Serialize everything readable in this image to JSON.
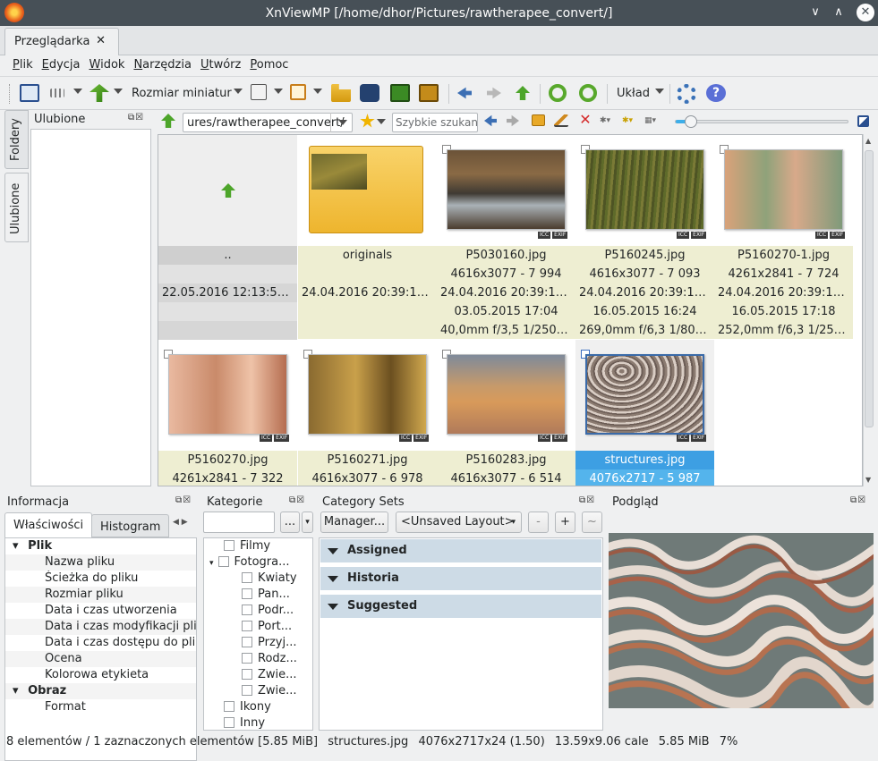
{
  "window": {
    "title": "XnViewMP [/home/dhor/Pictures/rawtherapee_convert/]",
    "min": "∨",
    "max": "∧",
    "close": "✕"
  },
  "tab": {
    "label": "Przeglądarka",
    "close": "✕"
  },
  "menu": [
    "Plik",
    "Edycja",
    "Widok",
    "Narzędzia",
    "Utwórz",
    "Pomoc"
  ],
  "toolbar": {
    "thumb_size": "Rozmiar miniatur",
    "layout": "Układ"
  },
  "sidetabs": {
    "folders": "Foldery",
    "favorites": "Ulubione"
  },
  "favorites": {
    "title": "Ulubione"
  },
  "address": {
    "path": "ures/rawtherapee_convert/",
    "search_placeholder": "Szybkie szukanie",
    "zoom_fraction": 0.07
  },
  "items": [
    {
      "name": "..",
      "size": "",
      "created": "22.05.2016 12:13:57 C...",
      "date": "",
      "exif": "",
      "type": "parent"
    },
    {
      "name": "originals",
      "size": "",
      "created": "24.04.2016 20:39:16 C...",
      "date": "",
      "exif": "",
      "type": "folder"
    },
    {
      "name": "P5030160.jpg",
      "size": "4616x3077 - 7 994",
      "created": "24.04.2016 20:39:17 C...",
      "date": "03.05.2015 17:04",
      "exif": "40,0mm f/3,5 1/250s 2...",
      "type": "photo"
    },
    {
      "name": "P5160245.jpg",
      "size": "4616x3077 - 7 093",
      "created": "24.04.2016 20:39:18 C...",
      "date": "16.05.2015 16:24",
      "exif": "269,0mm f/6,3 1/800s ...",
      "type": "photo"
    },
    {
      "name": "P5160270-1.jpg",
      "size": "4261x2841 - 7 724",
      "created": "24.04.2016 20:39:17 C...",
      "date": "16.05.2015 17:18",
      "exif": "252,0mm f/6,3 1/250s ...",
      "type": "photo"
    },
    {
      "name": "P5160270.jpg",
      "size": "4261x2841 - 7 322",
      "type": "photo"
    },
    {
      "name": "P5160271.jpg",
      "size": "4616x3077 - 6 978",
      "type": "photo"
    },
    {
      "name": "P5160283.jpg",
      "size": "4616x3077 - 6 514",
      "type": "photo"
    },
    {
      "name": "structures.jpg",
      "size": "4076x2717 - 5 987",
      "type": "photo",
      "selected": true
    }
  ],
  "badges": {
    "icc": "ICC",
    "exif": "EXIF"
  },
  "info": {
    "title": "Informacja",
    "tab_props": "Właściwości",
    "tab_hist": "Histogram",
    "rows": [
      {
        "label": "Plik",
        "group": true
      },
      {
        "label": "Nazwa pliku"
      },
      {
        "label": "Ścieżka do pliku"
      },
      {
        "label": "Rozmiar pliku"
      },
      {
        "label": "Data i czas utworzenia"
      },
      {
        "label": "Data i czas modyfikacji pli"
      },
      {
        "label": "Data i czas dostępu do pli"
      },
      {
        "label": "Ocena"
      },
      {
        "label": "Kolorowa etykieta"
      },
      {
        "label": "Obraz",
        "group": true
      },
      {
        "label": "Format"
      }
    ]
  },
  "categories": {
    "title": "Kategorie",
    "more": "...",
    "rows": [
      {
        "label": "Filmy",
        "level": 0
      },
      {
        "label": "Fotogra...",
        "level": 0,
        "expanded": true
      },
      {
        "label": "Kwiaty",
        "level": 1
      },
      {
        "label": "Pan...",
        "level": 1
      },
      {
        "label": "Podr...",
        "level": 1
      },
      {
        "label": "Port...",
        "level": 1
      },
      {
        "label": "Przyj...",
        "level": 1
      },
      {
        "label": "Rodz...",
        "level": 1
      },
      {
        "label": "Zwie...",
        "level": 1
      },
      {
        "label": "Zwie...",
        "level": 1
      },
      {
        "label": "Ikony",
        "level": 0
      },
      {
        "label": "Inny",
        "level": 0
      }
    ]
  },
  "category_sets": {
    "title": "Category Sets",
    "manager": "Manager...",
    "layout": "<Unsaved Layout>",
    "minus": "-",
    "plus": "+",
    "tilde": "~",
    "groups": [
      "Assigned",
      "Historia",
      "Suggested"
    ]
  },
  "preview": {
    "title": "Podgląd"
  },
  "status": {
    "count": "8 elementów / 1 zaznaczonych elementów [5.85 MiB]",
    "file": "structures.jpg",
    "dims": "4076x2717x24 (1.50)",
    "inches": "13.59x9.06 cale",
    "size": "5.85 MiB",
    "zoom": "7%"
  }
}
